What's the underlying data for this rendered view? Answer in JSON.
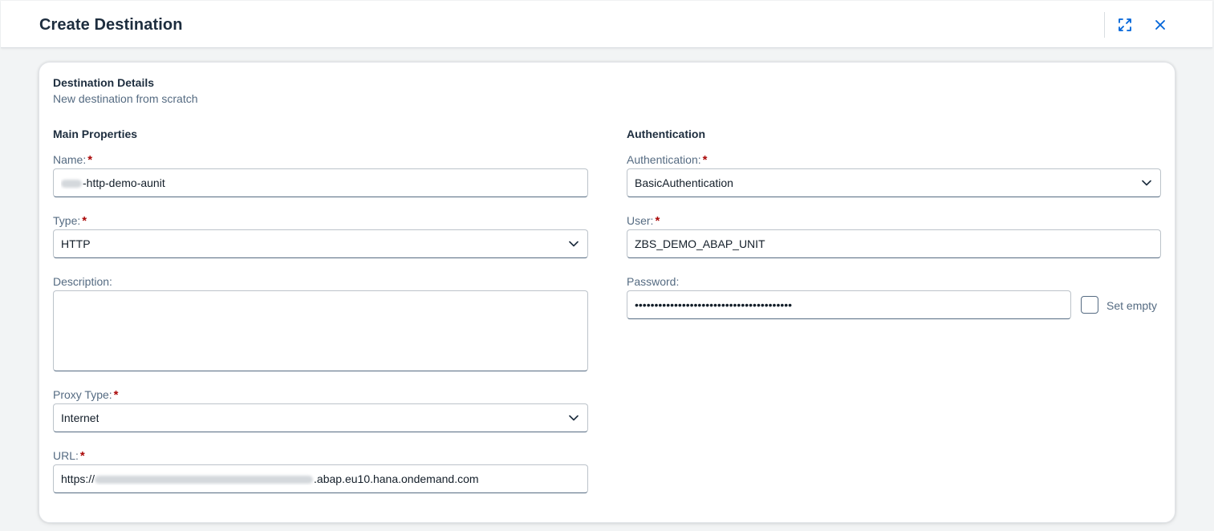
{
  "header": {
    "title": "Create Destination",
    "icons": {
      "fullscreen": "fullscreen-icon",
      "close": "close-icon"
    }
  },
  "details": {
    "title": "Destination Details",
    "subtitle": "New destination from scratch"
  },
  "main": {
    "section_title": "Main Properties",
    "name": {
      "label": "Name:",
      "required": "*",
      "value": "-http-demo-aunit"
    },
    "type": {
      "label": "Type:",
      "required": "*",
      "value": "HTTP"
    },
    "description": {
      "label": "Description:",
      "value": ""
    },
    "proxy_type": {
      "label": "Proxy Type:",
      "required": "*",
      "value": "Internet"
    },
    "url": {
      "label": "URL:",
      "required": "*",
      "prefix": "https://",
      "suffix": ".abap.eu10.hana.ondemand.com"
    }
  },
  "auth": {
    "section_title": "Authentication",
    "authentication": {
      "label": "Authentication:",
      "required": "*",
      "value": "BasicAuthentication"
    },
    "user": {
      "label": "User:",
      "required": "*",
      "value": "ZBS_DEMO_ABAP_UNIT"
    },
    "password": {
      "label": "Password:",
      "value": "••••••••••••••••••••••••••••••••••••••••"
    },
    "set_empty": {
      "label": "Set empty",
      "checked": false
    }
  },
  "colors": {
    "accent": "#0064d9",
    "required": "#aa0808",
    "label": "#556b82",
    "text": "#1d2d3e"
  }
}
